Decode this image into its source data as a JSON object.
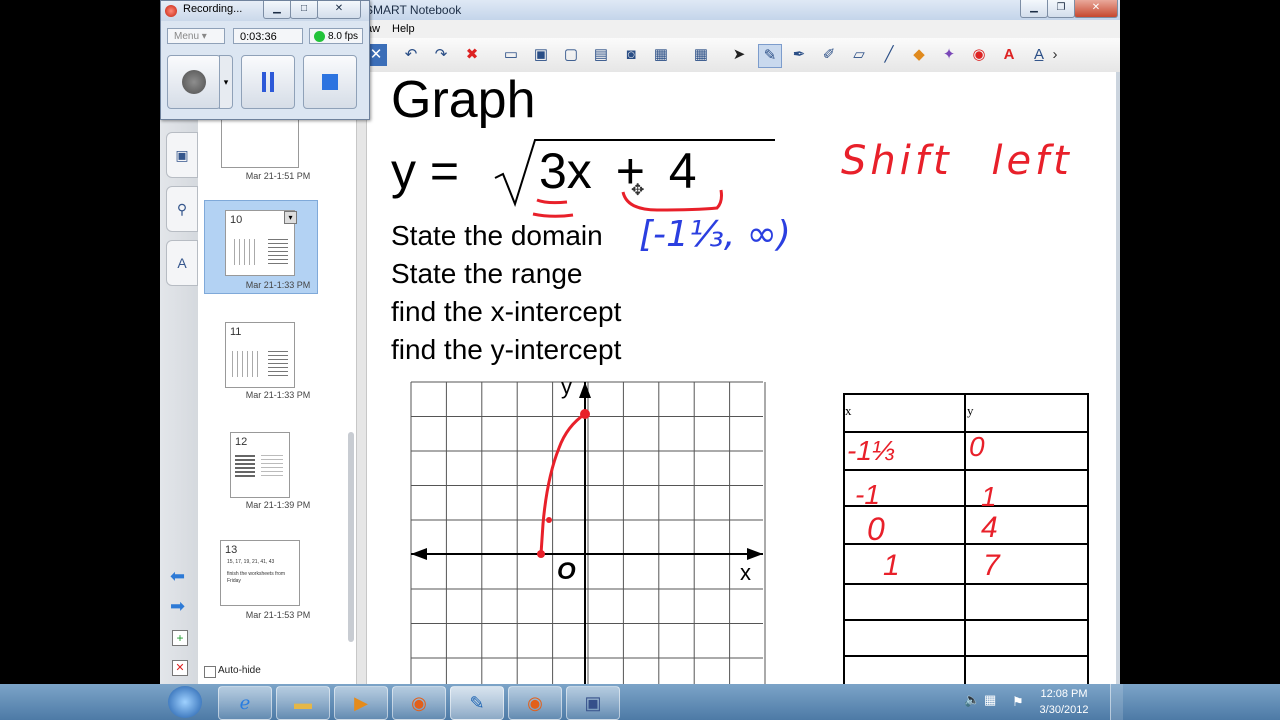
{
  "window": {
    "title": "SMART Notebook",
    "minimize": "▁",
    "maximize": "❐",
    "close": "✕"
  },
  "menu": {
    "draw": "aw",
    "help": "Help"
  },
  "recorder": {
    "title": "Recording...",
    "menu_label": "Menu",
    "elapsed": "0:03:36",
    "fps": "8.0 fps",
    "status_color": "#22c33a"
  },
  "page": {
    "heading": "Graph",
    "equation_lhs": "y =",
    "equation_radicand": "3x + 4",
    "instructions": [
      "State the domain",
      "State the range",
      "find the x-intercept",
      "find the y-intercept"
    ],
    "handwritten_note": "Shift left",
    "handwritten_domain": "[-1⅓, ∞)",
    "graph": {
      "y_label": "y",
      "x_label": "x",
      "origin_label": "O"
    },
    "table": {
      "headers": [
        "x",
        "y"
      ],
      "rows": [
        {
          "x": "-1⅓",
          "y": "0"
        },
        {
          "x": "-1",
          "y": "1"
        },
        {
          "x": "0",
          "y": "4"
        },
        {
          "x": "1",
          "y": "7"
        }
      ]
    }
  },
  "sorter": {
    "pages": [
      {
        "num": "",
        "date": "Mar 21-1:51 PM"
      },
      {
        "num": "10",
        "date": "Mar 21-1:33 PM"
      },
      {
        "num": "11",
        "date": "Mar 21-1:33 PM"
      },
      {
        "num": "12",
        "date": "Mar 21-1:39 PM"
      },
      {
        "num": "13",
        "date": "Mar 21-1:53 PM",
        "lines": [
          "15, 17, 19, 21, 41, 43",
          "finish the worksheets from",
          "Friday"
        ]
      }
    ],
    "auto_hide": "Auto-hide"
  },
  "taskbar": {
    "time": "12:08 PM",
    "date": "3/30/2012"
  },
  "colors": {
    "ink_red": "#e8202a",
    "ink_blue": "#2b3fe0"
  }
}
